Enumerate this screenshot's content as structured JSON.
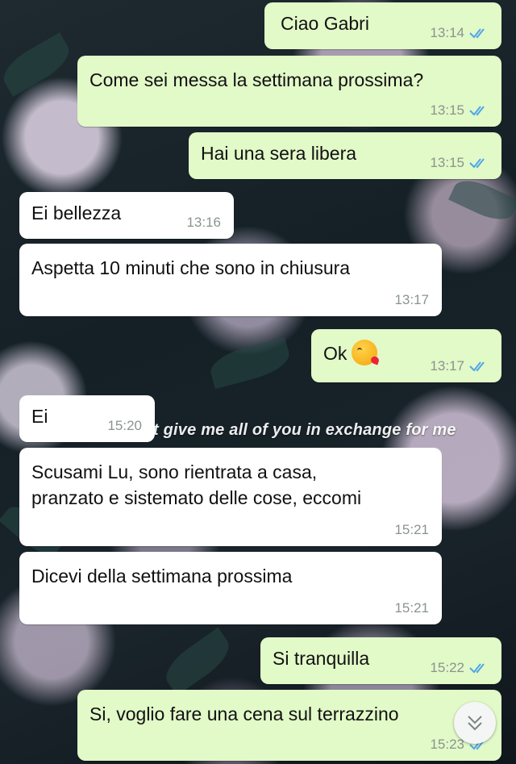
{
  "overlay_caption": "t give me all of you in exchange for me",
  "messages": [
    {
      "dir": "out",
      "text": "Ciao Gabri",
      "time": "13:14",
      "status": "read"
    },
    {
      "dir": "out",
      "text": "Come sei messa la settimana prossima?",
      "time": "13:15",
      "status": "read"
    },
    {
      "dir": "out",
      "text": "Hai una sera libera",
      "time": "13:15",
      "status": "read"
    },
    {
      "dir": "in",
      "text": "Ei bellezza",
      "time": "13:16"
    },
    {
      "dir": "in",
      "text": "Aspetta 10 minuti che sono in chiusura",
      "time": "13:17"
    },
    {
      "dir": "out",
      "text": "Ok",
      "emoji": "kissing-face-emoji",
      "time": "13:17",
      "status": "read"
    },
    {
      "dir": "in",
      "text": "Ei",
      "time": "15:20"
    },
    {
      "dir": "in",
      "text": "Scusami Lu, sono rientrata a casa,\npranzato e sistemato delle cose, eccomi",
      "time": "15:21"
    },
    {
      "dir": "in",
      "text": "Dicevi della settimana prossima",
      "time": "15:21"
    },
    {
      "dir": "out",
      "text": "Si tranquilla",
      "time": "15:22",
      "status": "read"
    },
    {
      "dir": "out",
      "text": "Si, voglio fare una cena sul terrazzino",
      "time": "15:23",
      "status": "read"
    }
  ],
  "colors": {
    "outgoing_bubble": "#e2f9c8",
    "incoming_bubble": "#ffffff",
    "read_tick": "#4fa6e8",
    "timestamp": "#8a948e"
  },
  "icons": {
    "read_receipt": "double-check-icon",
    "scroll_down": "chevron-double-down-icon"
  }
}
